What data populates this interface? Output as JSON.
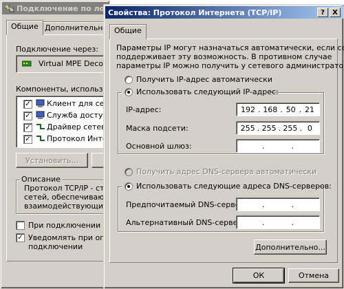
{
  "back_window": {
    "title": "Подключение по лока",
    "tabs": [
      "Общие",
      "Дополнительно"
    ],
    "connect_via_label": "Подключение через:",
    "adapter_name": "Virtual MPE Decode",
    "components_label": "Компоненты, используем",
    "components": [
      {
        "label": "Клиент для сете",
        "checked": true
      },
      {
        "label": "Служба доступа",
        "checked": true
      },
      {
        "label": "Драйвер сетево",
        "checked": true
      },
      {
        "label": "Протокол Интерн",
        "checked": true
      }
    ],
    "install_button": "Установить...",
    "description_label": "Описание",
    "description_text": [
      "Протокол TCP/IP - ста",
      "сетей, обеспечиваю",
      "взаимодействующим"
    ],
    "check1": {
      "label": "При подключении вы",
      "checked": false
    },
    "check2": {
      "label": "Уведомлять при огра",
      "label2": "подключении",
      "checked": true
    }
  },
  "dialog": {
    "title": "Свойства: Протокол Интернета (TCP/IP)",
    "help_button": "?",
    "close_button": "X",
    "tab": "Общие",
    "intro": [
      "Параметры IP могут назначаться автоматически, если сеть",
      "поддерживает эту возможность. В противном случае",
      "параметры IP можно получить у сетевого администратора."
    ],
    "radio_auto_ip": {
      "label": "Получить IP-адрес автоматически",
      "selected": false
    },
    "radio_manual_ip": {
      "label": "Использовать следующий IP-адрес:",
      "selected": true
    },
    "ip_label": "IP-адрес:",
    "ip_value": [
      "192",
      "168",
      "50",
      "21"
    ],
    "mask_label": "Маска подсети:",
    "mask_value": [
      "255",
      "255",
      "255",
      "0"
    ],
    "gateway_label": "Основной шлюз:",
    "gateway_value": [
      "",
      "",
      "",
      ""
    ],
    "radio_auto_dns": {
      "label": "Получить адрес DNS-сервера автоматически",
      "selected": false
    },
    "radio_manual_dns": {
      "label": "Использовать следующие адреса DNS-серверов:",
      "selected": true
    },
    "dns1_label": "Предпочитаемый DNS-сервер:",
    "dns1_value": [
      "",
      "",
      "",
      ""
    ],
    "dns2_label": "Альтернативный DNS-сервер:",
    "dns2_value": [
      "",
      "",
      "",
      ""
    ],
    "advanced_button": "Дополнительно...",
    "ok_button": "ОК",
    "cancel_button": "Отмена"
  },
  "colors": {
    "face": "#d4d0c8",
    "active_title": "#0a246a",
    "inactive_title": "#808080"
  }
}
